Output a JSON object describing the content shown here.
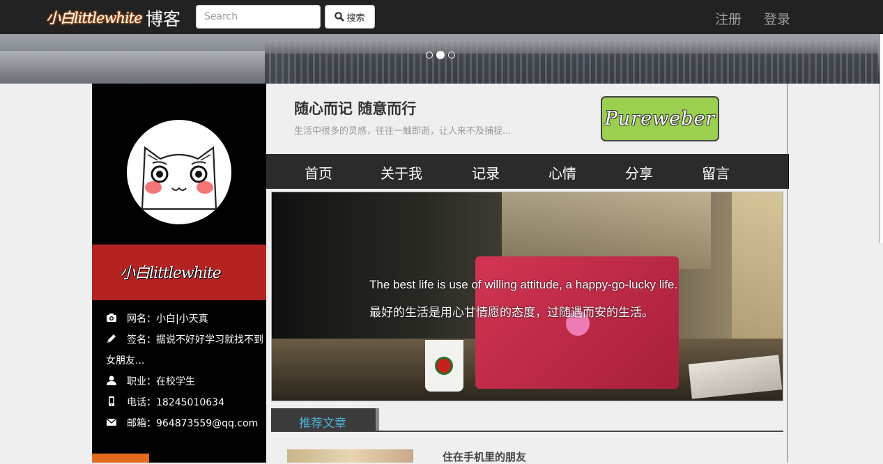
{
  "topnav": {
    "logo_text": "小白littlewhite",
    "brand": "博客",
    "search_placeholder": "Search",
    "search_button": "搜索",
    "register": "注册",
    "login": "登录"
  },
  "carousel": {
    "slides": 3,
    "active_index": 1
  },
  "sidebar": {
    "logo_text": "小白littlewhite",
    "info": [
      {
        "icon": "camera-icon",
        "label": "网名：小白|小天真"
      },
      {
        "icon": "pencil-icon",
        "label": "签名：据说不好好学习就找不到女朋友..."
      },
      {
        "icon": "user-icon",
        "label": "职业：在校学生"
      },
      {
        "icon": "phone-icon",
        "label": "电话：18245010634"
      },
      {
        "icon": "envelope-icon",
        "label": "邮箱：964873559@qq.com"
      }
    ]
  },
  "header": {
    "motto": "随心而记 随意而行",
    "subtitle": "生活中很多的灵感，往往一触即逝，让人来不及捕捉...",
    "badge": "Pureweber"
  },
  "menu": [
    "首页",
    "关于我",
    "记录",
    "心情",
    "分享",
    "留言"
  ],
  "hero": {
    "quote_en": "The best life is use of willing attitude, a happy-go-lucky life.",
    "quote_cn": "最好的生活是用心甘情愿的态度，过随遇而安的生活。"
  },
  "recommend": {
    "tab_label": "推荐文章",
    "first_post_title": "住在手机里的朋友"
  }
}
